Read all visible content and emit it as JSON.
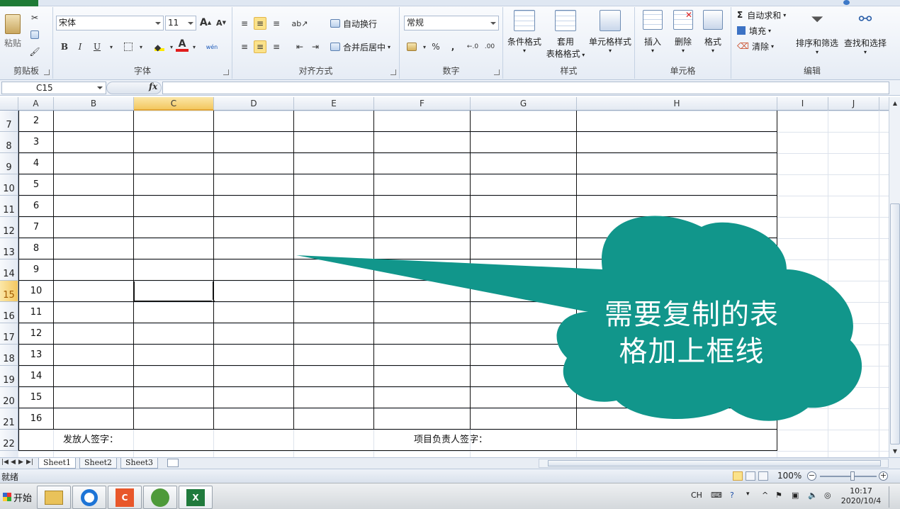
{
  "ribbon": {
    "clipboard": {
      "label": "剪贴板",
      "paste": "粘贴"
    },
    "font": {
      "label": "字体",
      "font_name": "宋体",
      "font_size": "11",
      "bold": "B",
      "italic": "I",
      "underline": "U",
      "grow": "A",
      "shrink": "A",
      "font_color_letter": "A",
      "phonetic": "wén"
    },
    "alignment": {
      "label": "对齐方式",
      "wrap_text": "自动换行",
      "merge_center": "合并后居中"
    },
    "number": {
      "label": "数字",
      "format": "常规",
      "percent": "%",
      "comma": ","
    },
    "styles": {
      "label": "样式",
      "conditional": "条件格式",
      "table_format_1": "套用",
      "table_format_2": "表格格式",
      "cell_styles": "单元格样式"
    },
    "cells": {
      "label": "单元格",
      "insert": "插入",
      "delete": "删除",
      "format": "格式"
    },
    "editing": {
      "label": "编辑",
      "autosum": "自动求和",
      "sigma": "Σ",
      "fill": "填充",
      "clear": "清除",
      "sort_filter": "排序和筛选",
      "find_select": "查找和选择"
    }
  },
  "formula_bar": {
    "name_box": "C15",
    "fx": "fx",
    "formula": ""
  },
  "columns": [
    "A",
    "B",
    "C",
    "D",
    "E",
    "F",
    "G",
    "H",
    "I",
    "J"
  ],
  "active_column": "C",
  "rows": [
    {
      "header": "7",
      "value": "2"
    },
    {
      "header": "8",
      "value": "3"
    },
    {
      "header": "9",
      "value": "4"
    },
    {
      "header": "10",
      "value": "5"
    },
    {
      "header": "11",
      "value": "6"
    },
    {
      "header": "12",
      "value": "7"
    },
    {
      "header": "13",
      "value": "8"
    },
    {
      "header": "14",
      "value": "9"
    },
    {
      "header": "15",
      "value": "10"
    },
    {
      "header": "16",
      "value": "11"
    },
    {
      "header": "17",
      "value": "12"
    },
    {
      "header": "18",
      "value": "13"
    },
    {
      "header": "19",
      "value": "14"
    },
    {
      "header": "20",
      "value": "15"
    },
    {
      "header": "21",
      "value": "16"
    },
    {
      "header": "22",
      "value": ""
    }
  ],
  "active_row": "15",
  "signatures": {
    "issuer": "发放人签字：",
    "project_lead": "项目负责人签字："
  },
  "sheet_tabs": [
    "Sheet1",
    "Sheet2",
    "Sheet3"
  ],
  "active_sheet": "Sheet1",
  "status": {
    "ready": "就绪",
    "zoom": "100%",
    "zoom_minus": "−",
    "zoom_plus": "+"
  },
  "taskbar": {
    "start": "开始",
    "ime": "CH",
    "time": "10:17",
    "date": "2020/10/4"
  },
  "callout": {
    "line1": "需要复制的表",
    "line2": "格加上框线",
    "color": "#11968b"
  },
  "colors": {
    "selection_highlight": "#f3c760",
    "ribbon_bg": "#e6ecf5"
  }
}
